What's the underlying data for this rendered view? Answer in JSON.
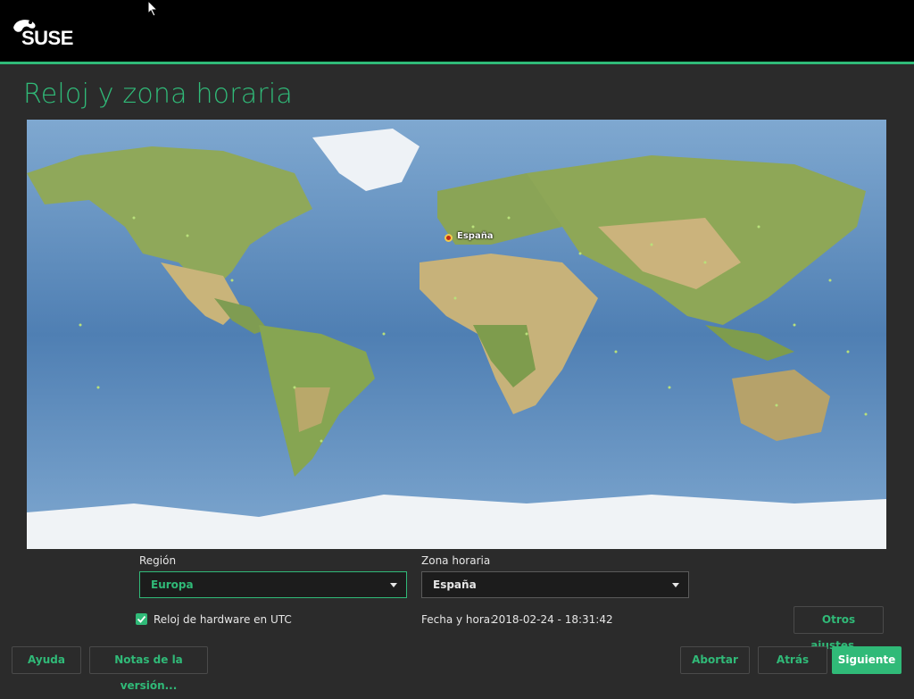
{
  "header": {
    "logo_text": "SUSE"
  },
  "page": {
    "title": "Reloj y zona horaria"
  },
  "map": {
    "selected_marker_label": "España"
  },
  "form": {
    "region_label": "Región",
    "region_value": "Europa",
    "timezone_label": "Zona horaria",
    "timezone_value": "España",
    "utc_checkbox_label": "Reloj de hardware en UTC",
    "utc_checked": true,
    "datetime_label": "Fecha y hora:",
    "datetime_value": "2018-02-24 - 18:31:42",
    "other_settings_label": "Otros ajustes..."
  },
  "footer": {
    "help_label": "Ayuda",
    "release_notes_label": "Notas de la versión...",
    "abort_label": "Abortar",
    "back_label": "Atrás",
    "next_label": "Siguiente"
  },
  "colors": {
    "accent": "#30ba78",
    "background": "#2b2b2b",
    "header": "#000000"
  },
  "icons": [
    "suse-chameleon-logo",
    "mouse-cursor-icon",
    "chevron-down-icon",
    "checkmark-icon",
    "location-pin-icon",
    "help-circle-icon"
  ]
}
